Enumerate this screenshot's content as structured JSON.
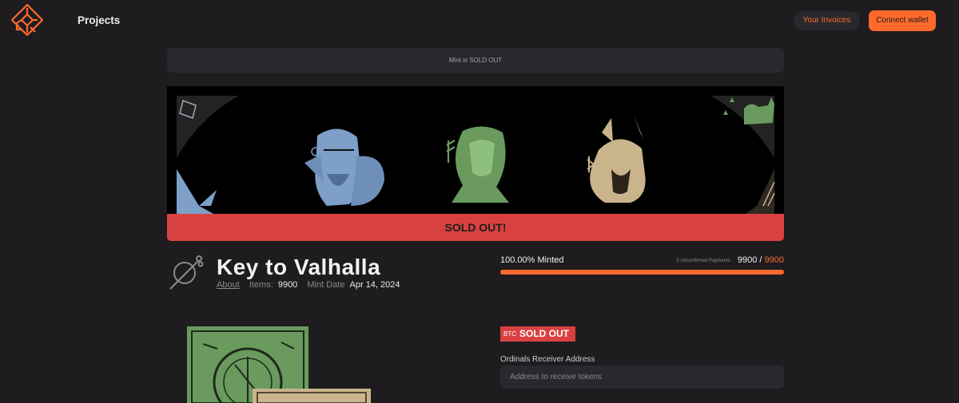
{
  "header": {
    "nav_projects": "Projects",
    "invoices_label": "Your Invoices",
    "connect_label": "Connect wallet"
  },
  "notice": "Mint is SOLD OUT",
  "banner": {
    "sold_label": "SOLD OUT!"
  },
  "collection": {
    "title": "Key to Valhalla",
    "about": "About",
    "items_label": "Items:",
    "items_value": "9900",
    "mint_date_label": "Mint Date",
    "mint_date_value": "Apr 14, 2024"
  },
  "mint": {
    "minted_label": "100.00% Minted",
    "unconfirmed": "0 Unconfirmed Payments",
    "minted_count": "9900",
    "separator": "/",
    "total_count": "9900",
    "progress_fraction": 1.0
  },
  "status": {
    "currency": "BTC",
    "label": "SOLD OUT"
  },
  "address": {
    "label": "Ordinals Receiver Address",
    "placeholder": "Address to receive tokens"
  },
  "colors": {
    "accent": "#ff6a2b",
    "sold_red": "#d94141",
    "background": "#1e1c1f",
    "panel": "#2a282c"
  }
}
